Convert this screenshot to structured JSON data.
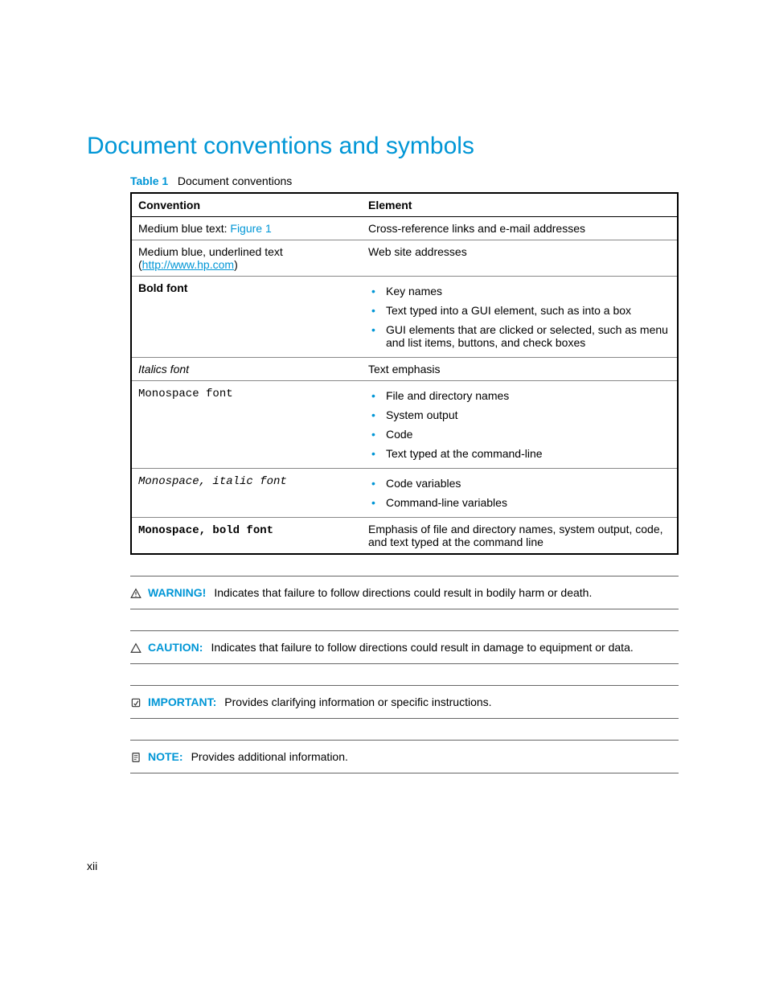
{
  "heading": "Document conventions and symbols",
  "table": {
    "label": "Table 1",
    "caption": "Document conventions",
    "headers": {
      "col1": "Convention",
      "col2": "Element"
    },
    "rows": {
      "r1": {
        "conv_prefix": "Medium blue text: ",
        "conv_link": "Figure 1",
        "element": "Cross-reference links and e-mail addresses"
      },
      "r2": {
        "conv_line1": "Medium blue, underlined text",
        "conv_open": "(",
        "conv_url": "http://www.hp.com",
        "conv_close": ")",
        "element": "Web site addresses"
      },
      "r3": {
        "conv": "Bold font",
        "items": {
          "i1": "Key names",
          "i2": "Text typed into a GUI element, such as into a box",
          "i3": "GUI elements that are clicked or selected, such as menu and list items, buttons, and check boxes"
        }
      },
      "r4": {
        "conv": "Italics font",
        "element": "Text emphasis"
      },
      "r5": {
        "conv": "Monospace font",
        "items": {
          "i1": "File and directory names",
          "i2": "System output",
          "i3": "Code",
          "i4": "Text typed at the command-line"
        }
      },
      "r6": {
        "conv": "Monospace, italic font",
        "items": {
          "i1": "Code variables",
          "i2": "Command-line variables"
        }
      },
      "r7": {
        "conv": "Monospace, bold font",
        "element": "Emphasis of file and directory names, system output, code, and text typed at the command line"
      }
    }
  },
  "notices": {
    "warning": {
      "label": "WARNING!",
      "text": "Indicates that failure to follow directions could result in bodily harm or death."
    },
    "caution": {
      "label": "CAUTION:",
      "text": "Indicates that failure to follow directions could result in damage to equipment or data."
    },
    "important": {
      "label": "IMPORTANT:",
      "text": "Provides clarifying information or specific instructions."
    },
    "note": {
      "label": "NOTE:",
      "text": "Provides additional information."
    }
  },
  "footer": {
    "page_number": "xii"
  }
}
